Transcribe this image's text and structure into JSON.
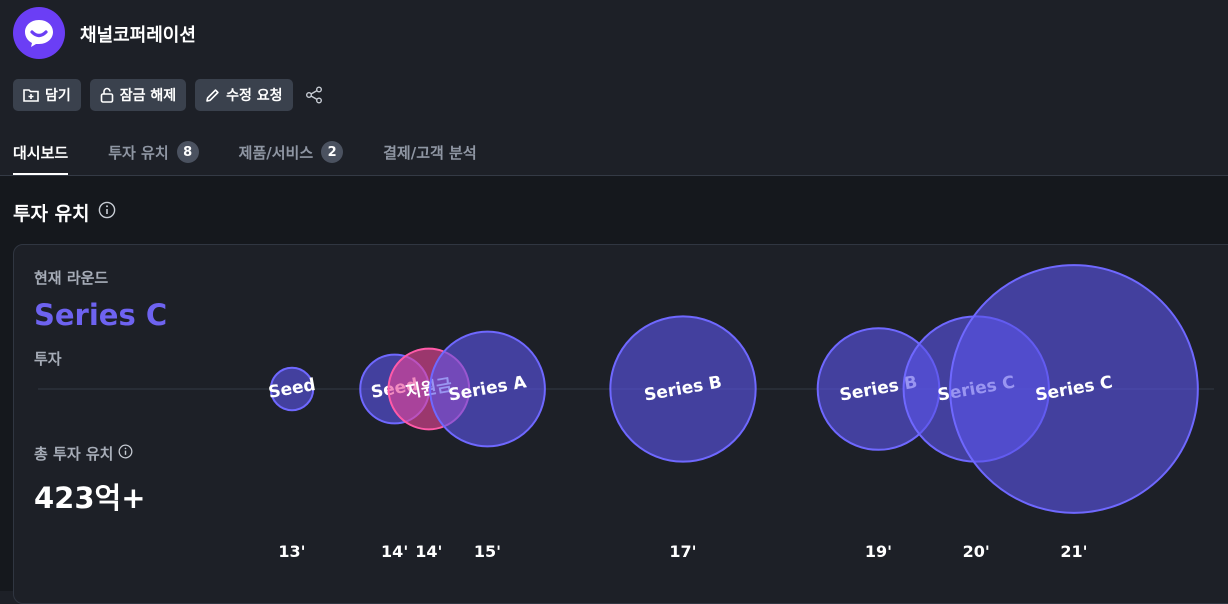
{
  "company": {
    "name": "채널코퍼레이션",
    "logo_icon": "chat-bubble-logo-icon",
    "brand_color": "#6b3ef5"
  },
  "actions": {
    "save_label": "담기",
    "unlock_label": "잠금 해제",
    "edit_label": "수정 요청",
    "share_icon": "share-icon"
  },
  "tabs": [
    {
      "label": "대시보드",
      "active": true
    },
    {
      "label": "투자 유치",
      "count": "8"
    },
    {
      "label": "제품/서비스",
      "count": "2"
    },
    {
      "label": "결제/고객 분석"
    }
  ],
  "section": {
    "title": "투자 유치"
  },
  "summary": {
    "current_round_label": "현재 라운드",
    "current_round": "Series C",
    "current_round_sub": "투자",
    "total_label": "총 투자 유치",
    "total_value": "423억+"
  },
  "chart_data": {
    "type": "scatter",
    "points": [
      {
        "label": "Seed",
        "year": "13'",
        "pos": 13.0,
        "size": 1,
        "color": "#5b54e8"
      },
      {
        "label": "Seed",
        "year": "14'",
        "pos": 14.05,
        "size": 4,
        "color": "#5b54e8"
      },
      {
        "label": "지원금",
        "year": "14'",
        "pos": 14.4,
        "size": 6,
        "color": "#e8459a"
      },
      {
        "label": "Series A",
        "year": "15'",
        "pos": 15.0,
        "size": 14,
        "color": "#5b54e8"
      },
      {
        "label": "Series B",
        "year": "17'",
        "pos": 17.0,
        "size": 24,
        "color": "#5b54e8"
      },
      {
        "label": "Series B",
        "year": "19'",
        "pos": 19.0,
        "size": 16,
        "color": "#5b54e8"
      },
      {
        "label": "Series C",
        "year": "20'",
        "pos": 20.0,
        "size": 24,
        "color": "#5b54e8"
      },
      {
        "label": "Series C",
        "year": "21'",
        "pos": 21.0,
        "size": 77,
        "color": "#5b54e8"
      }
    ]
  },
  "colors": {
    "accent": "#6e63f0",
    "grant": "#e8459a",
    "bubble": "#5b54e8"
  }
}
